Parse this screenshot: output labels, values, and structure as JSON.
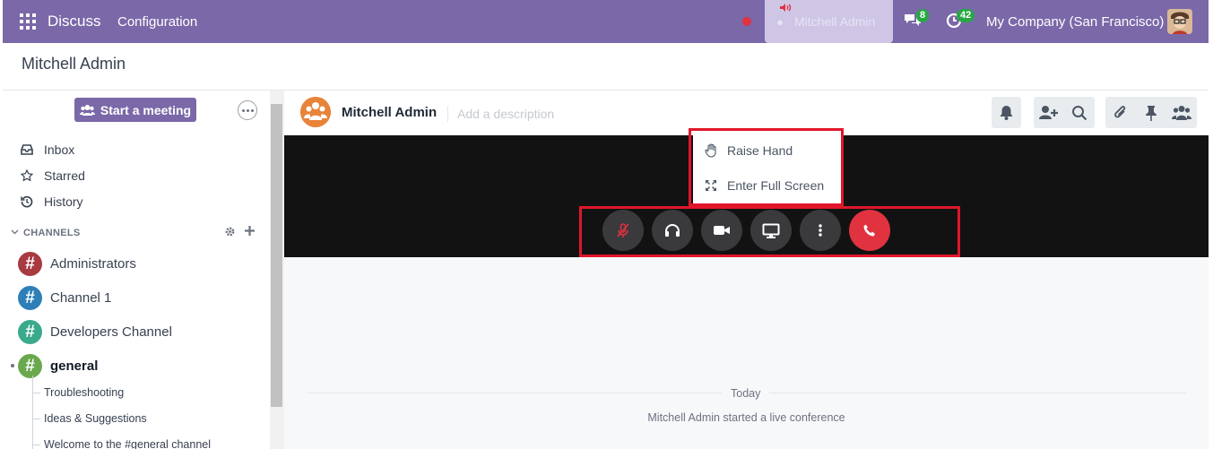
{
  "navbar": {
    "app_name": "Discuss",
    "menu_configuration": "Configuration",
    "call_user": "Mitchell Admin",
    "chat_count": "8",
    "activity_count": "42",
    "company": "My Company (San Francisco)"
  },
  "breadcrumb": {
    "title": "Mitchell Admin"
  },
  "sidebar": {
    "start_meeting": "Start a meeting",
    "mailboxes": [
      {
        "label": "Inbox",
        "icon": "inbox-icon"
      },
      {
        "label": "Starred",
        "icon": "star-icon"
      },
      {
        "label": "History",
        "icon": "history-icon"
      }
    ],
    "channels_header": "CHANNELS",
    "channels": [
      {
        "name": "Administrators",
        "color": "#a83a42"
      },
      {
        "name": "Channel 1",
        "color": "#2e7fb8"
      },
      {
        "name": "Developers Channel",
        "color": "#3aaa8c"
      },
      {
        "name": "general",
        "color": "#6aa84f"
      }
    ],
    "sub_threads": [
      "Troubleshooting",
      "Ideas & Suggestions",
      "Welcome to the #general channel"
    ]
  },
  "thread": {
    "name": "Mitchell Admin",
    "description_placeholder": "Add a description"
  },
  "call_menu": {
    "items": [
      {
        "label": "Raise Hand",
        "icon": "hand-icon"
      },
      {
        "label": "Enter Full Screen",
        "icon": "expand-icon"
      }
    ]
  },
  "call_controls": [
    "mute-icon",
    "headphones-icon",
    "camera-icon",
    "screen-share-icon",
    "more-vertical-icon",
    "hang-up-icon"
  ],
  "messages": {
    "date_separator": "Today",
    "notification": "Mitchell Admin started a live conference"
  },
  "colors": {
    "brand": "#7a68a8",
    "highlight": "#e0172b",
    "hangup": "#e0323f",
    "badge": "#28a745"
  }
}
